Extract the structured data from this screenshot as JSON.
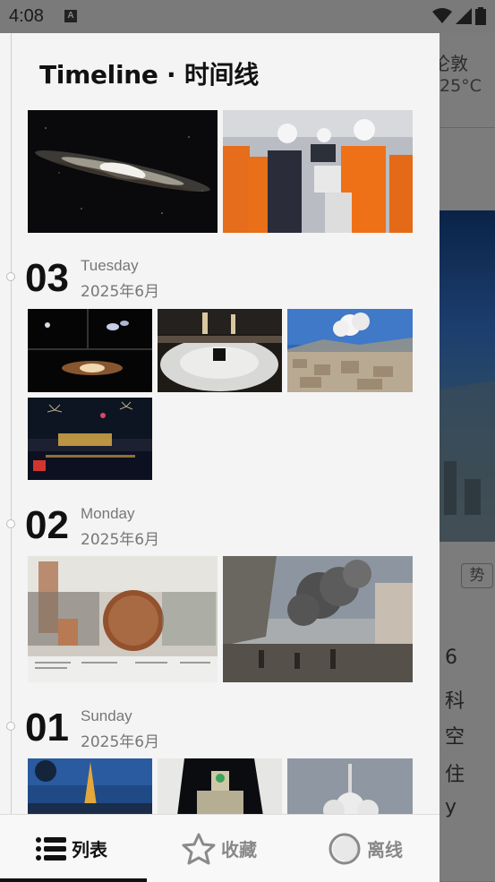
{
  "status_bar": {
    "time": "4:08",
    "notification_icon": "A"
  },
  "background_app": {
    "city": "伦敦",
    "temperature": "25°C",
    "tag": "势",
    "text_lines": [
      "6",
      "科",
      "空",
      "住",
      "y"
    ]
  },
  "drawer": {
    "title": "Timeline · 时间线",
    "days": [
      {
        "num": "03",
        "weekday": "Tuesday",
        "month": "2025年6月"
      },
      {
        "num": "02",
        "weekday": "Monday",
        "month": "2025年6月"
      },
      {
        "num": "01",
        "weekday": "Sunday",
        "month": "2025年6月"
      }
    ]
  },
  "bottom_nav": {
    "items": [
      {
        "label": "列表",
        "icon": "list-icon",
        "active": true
      },
      {
        "label": "收藏",
        "icon": "star-icon",
        "active": false
      },
      {
        "label": "离线",
        "icon": "offline-icon",
        "active": false
      }
    ]
  },
  "colors": {
    "drawer_bg": "#f4f4f4",
    "active_text": "#111111",
    "inactive_text": "#888888",
    "scrim": "#7c7c7c"
  }
}
